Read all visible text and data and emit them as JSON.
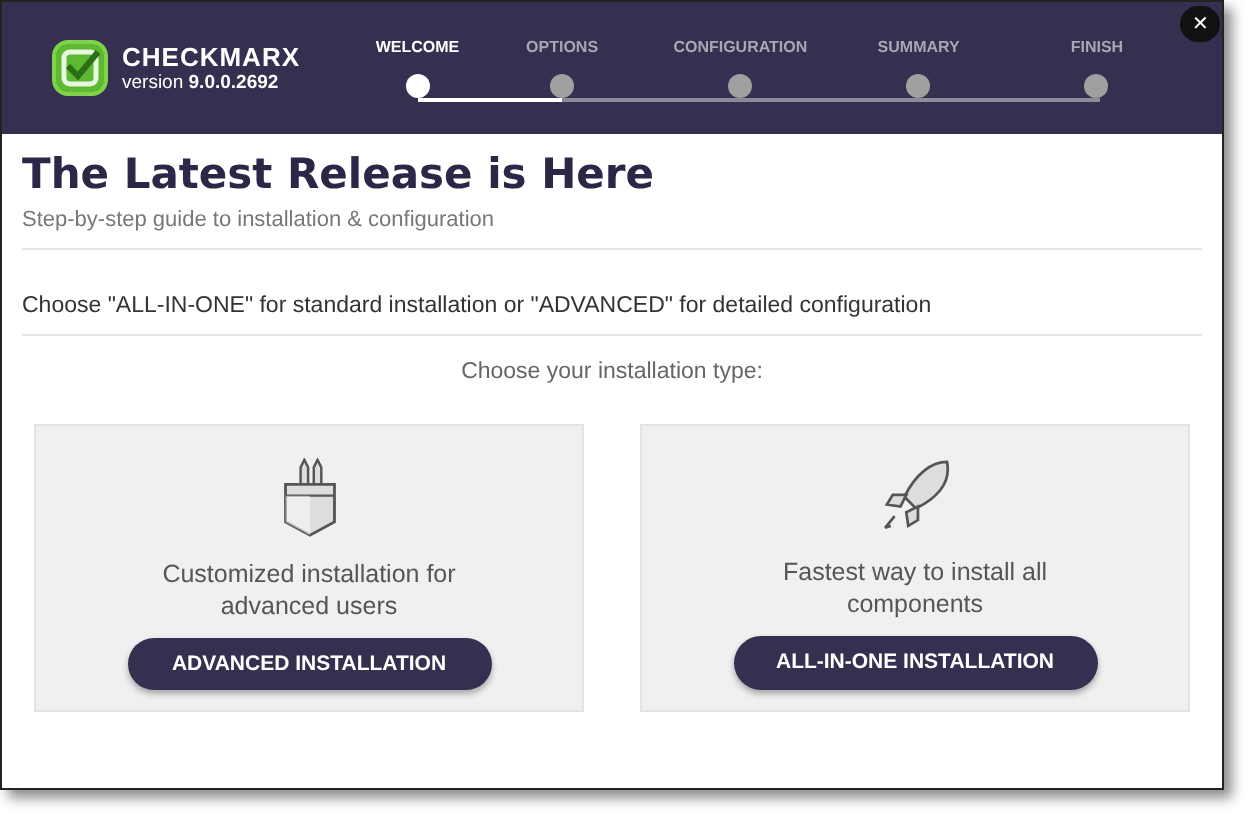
{
  "header": {
    "brand": "CHECKMARX",
    "version": "version **9.0.0.2692**",
    "close": "✕"
  },
  "steps": [
    {
      "label": "WELCOME",
      "selected": true
    },
    {
      "label": "OPTIONS",
      "selected": false
    },
    {
      "label": "CONFIGURATION",
      "selected": false
    },
    {
      "label": "SUMMARY",
      "selected": false
    },
    {
      "label": "FINISH",
      "selected": false
    }
  ],
  "title": "The Latest Release is Here",
  "subtitle": "Step-by-step guide to installation & configuration",
  "instruction": "Choose \"ALL-IN-ONE\" for standard installation or \"ADVANCED\" for detailed configuration",
  "prompt": "Choose your installation type:",
  "options": [
    {
      "kind": "pocket",
      "description": "Customized installation for advanced users",
      "button": "ADVANCED INSTALLATION"
    },
    {
      "kind": "rocket",
      "description": "Fastest way to install all components",
      "button": "ALL-IN-ONE INSTALLATION"
    }
  ]
}
